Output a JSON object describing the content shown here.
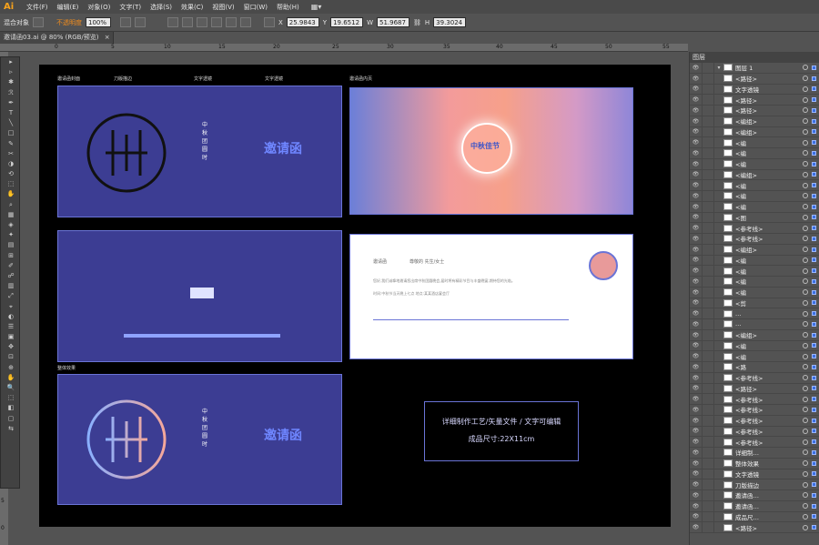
{
  "app": {
    "logo": "Ai",
    "menus": [
      "文件(F)",
      "编辑(E)",
      "对象(O)",
      "文字(T)",
      "选择(S)",
      "效果(C)",
      "视图(V)",
      "窗口(W)",
      "帮助(H)"
    ]
  },
  "options": {
    "object_type": "混合对象",
    "opacity_label": "不透明度",
    "opacity_value": "100%",
    "x": "25.9843",
    "y": "19.6512",
    "w": "51.9687",
    "h": "39.3024"
  },
  "doc_tab": "邀请函03.ai @ 80% (RGB/预览)",
  "ruler": [
    "0",
    "5",
    "10",
    "15",
    "20",
    "25",
    "30",
    "35",
    "40",
    "45",
    "50",
    "55"
  ],
  "vruler": [
    "5",
    "1",
    "0",
    "1",
    "5",
    "2",
    "0",
    "2",
    "5",
    "3",
    "0",
    "3",
    "5",
    "4",
    "0"
  ],
  "tools": [
    "▸",
    "▹",
    "✱",
    "ℛ",
    "✒",
    "T",
    "╲",
    "□",
    "✎",
    "✂",
    "◑",
    "⟲",
    "⬚",
    "✋",
    "⌕",
    "▦",
    "◈",
    "✦",
    "▤",
    "⊞",
    "✐",
    "☍",
    "▥",
    "⤢",
    "⌖",
    "◐",
    "☰",
    "▣",
    "✥",
    "⊡",
    "⊕",
    "✋",
    "🔍",
    "⬚",
    "◧",
    "▢",
    "⇆"
  ],
  "canvas": {
    "labels": {
      "cover": "邀请函封面",
      "knife": "刀版描边",
      "text": "文字透镜",
      "text2": "文字透镜",
      "inner": "邀请函内页",
      "overall": "整体效果"
    },
    "cover_vertical": [
      "中",
      "秋",
      "团",
      "圆",
      "时"
    ],
    "cover_title": "邀请函",
    "inner_badge": "中秋佳节",
    "white_lines": [
      "邀请函",
      "尊敬的  先生/女士",
      "您好,我们诚挚地邀请您出席中秋团圆晚会,届时将有精彩节目与丰盛晚宴,期待您的光临。",
      "时间:中秋节当天晚上七点  地点:某某酒店宴会厅"
    ],
    "info": {
      "line1": "详细制作工艺/矢量文件 / 文字可编辑",
      "line2": "成品尺寸:22X11cm"
    }
  },
  "panel": {
    "title": "图层",
    "layers": [
      {
        "name": "图层 1",
        "thumb": true
      },
      {
        "name": "<路径>"
      },
      {
        "name": "文字透镜"
      },
      {
        "name": "<路径>"
      },
      {
        "name": "<路径>"
      },
      {
        "name": "<编组>"
      },
      {
        "name": "<编组>"
      },
      {
        "name": "<编"
      },
      {
        "name": "<编"
      },
      {
        "name": "<编"
      },
      {
        "name": "<编组>"
      },
      {
        "name": "<编"
      },
      {
        "name": "<编"
      },
      {
        "name": "<编"
      },
      {
        "name": "<图"
      },
      {
        "name": "<参考线>"
      },
      {
        "name": "<参考线>"
      },
      {
        "name": "<编组>"
      },
      {
        "name": "<编"
      },
      {
        "name": "<编"
      },
      {
        "name": "<编"
      },
      {
        "name": "<编"
      },
      {
        "name": "<剪"
      },
      {
        "name": "…"
      },
      {
        "name": "…"
      },
      {
        "name": "<编组>"
      },
      {
        "name": "<编"
      },
      {
        "name": "<编"
      },
      {
        "name": "<路"
      },
      {
        "name": "<参考线>"
      },
      {
        "name": "<路径>"
      },
      {
        "name": "<参考线>"
      },
      {
        "name": "<参考线>"
      },
      {
        "name": "<参考线>"
      },
      {
        "name": "<参考线>"
      },
      {
        "name": "<参考线>"
      },
      {
        "name": "详细制…"
      },
      {
        "name": "整体效果"
      },
      {
        "name": "文字透镜"
      },
      {
        "name": "刀版描边"
      },
      {
        "name": "邀请函…"
      },
      {
        "name": "邀请函…"
      },
      {
        "name": "成品尺…"
      },
      {
        "name": "<路径>"
      }
    ]
  }
}
